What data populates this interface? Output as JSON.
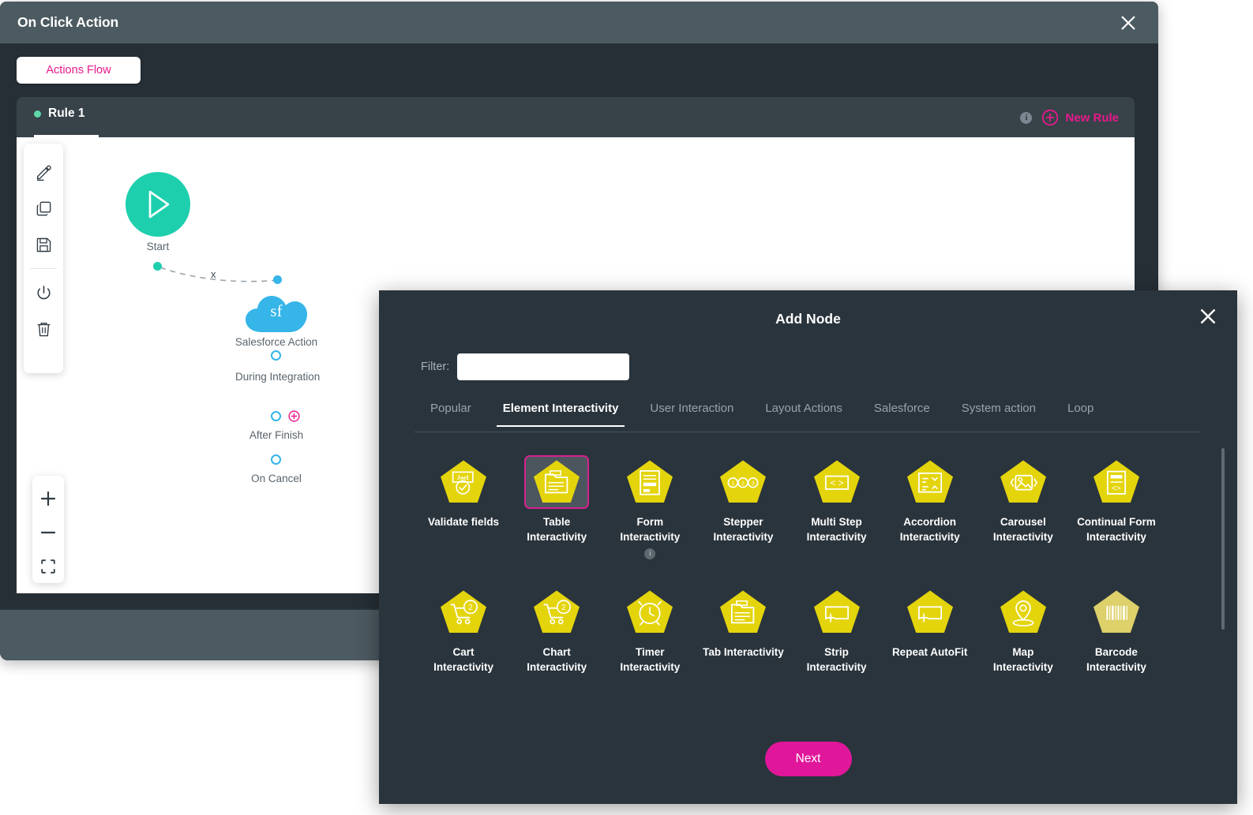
{
  "window": {
    "title": "On Click Action",
    "close_icon": "close-icon",
    "actions_flow_tab": "Actions Flow"
  },
  "rule_panel": {
    "tab_label": "Rule 1",
    "info_badge": "i",
    "new_rule_label": "New Rule",
    "new_rule_icon": "plus-circle-icon"
  },
  "canvas_toolbar": {
    "items": [
      {
        "name": "edit-tool",
        "icon": "pencil-icon"
      },
      {
        "name": "duplicate-tool",
        "icon": "copy-icon"
      },
      {
        "name": "save-tool",
        "icon": "save-icon"
      },
      {
        "name": "power-tool",
        "icon": "power-icon"
      },
      {
        "name": "delete-tool",
        "icon": "trash-icon"
      }
    ]
  },
  "zoom_controls": {
    "zoom_in": "+",
    "zoom_out": "–",
    "fit": "fit-to-screen-icon"
  },
  "flow": {
    "start_node": {
      "label": "Start",
      "icon": "play-icon"
    },
    "edge_label": "x",
    "salesforce_node": {
      "label": "Salesforce Action",
      "glyph": "sf",
      "icon": "cloud-icon"
    },
    "branches": [
      {
        "label": "During Integration",
        "port": "blue-ring"
      },
      {
        "label": "After Finish",
        "port": "blue-ring",
        "add_icon": "plus-circle-icon"
      },
      {
        "label": "On Cancel",
        "port": "blue-ring"
      }
    ]
  },
  "modal": {
    "title": "Add Node",
    "close_icon": "close-icon",
    "filter_label": "Filter:",
    "filter_value": "",
    "filter_placeholder": "",
    "tabs": [
      {
        "label": "Popular",
        "active": false
      },
      {
        "label": "Element Interactivity",
        "active": true
      },
      {
        "label": "User Interaction",
        "active": false
      },
      {
        "label": "Layout Actions",
        "active": false
      },
      {
        "label": "Salesforce",
        "active": false
      },
      {
        "label": "System action",
        "active": false
      },
      {
        "label": "Loop",
        "active": false
      }
    ],
    "nodes": [
      {
        "label": "Validate fields",
        "icon": "badge-check-icon",
        "selected": false,
        "info": false,
        "dim": false
      },
      {
        "label": "Table Interactivity",
        "icon": "table-icon",
        "selected": true,
        "info": false,
        "dim": false
      },
      {
        "label": "Form Interactivity",
        "icon": "form-icon",
        "selected": false,
        "info": true,
        "dim": false
      },
      {
        "label": "Stepper Interactivity",
        "icon": "stepper-icon",
        "selected": false,
        "info": false,
        "dim": false
      },
      {
        "label": "Multi Step Interactivity",
        "icon": "code-brackets-icon",
        "selected": false,
        "info": false,
        "dim": false
      },
      {
        "label": "Accordion Interactivity",
        "icon": "accordion-icon",
        "selected": false,
        "info": false,
        "dim": false
      },
      {
        "label": "Carousel Interactivity",
        "icon": "carousel-image-icon",
        "selected": false,
        "info": false,
        "dim": false
      },
      {
        "label": "Continual Form Interactivity",
        "icon": "continual-form-icon",
        "selected": false,
        "info": false,
        "dim": false
      },
      {
        "label": "Cart Interactivity",
        "icon": "cart-icon",
        "selected": false,
        "info": false,
        "dim": false
      },
      {
        "label": "Chart Interactivity",
        "icon": "cart-icon",
        "selected": false,
        "info": false,
        "dim": false
      },
      {
        "label": "Timer Interactivity",
        "icon": "alarm-clock-icon",
        "selected": false,
        "info": false,
        "dim": false
      },
      {
        "label": "Tab Interactivity",
        "icon": "tab-icon",
        "selected": false,
        "info": false,
        "dim": false
      },
      {
        "label": "Strip Interactivity",
        "icon": "strip-plus-icon",
        "selected": false,
        "info": false,
        "dim": false
      },
      {
        "label": "Repeat AutoFit",
        "icon": "strip-plus-icon",
        "selected": false,
        "info": false,
        "dim": false
      },
      {
        "label": "Map Interactivity",
        "icon": "map-pin-icon",
        "selected": false,
        "info": false,
        "dim": false
      },
      {
        "label": "Barcode Interactivity",
        "icon": "barcode-icon",
        "selected": false,
        "info": false,
        "dim": true
      }
    ],
    "next_label": "Next",
    "node_info_glyph": "i"
  },
  "colors": {
    "accent_magenta": "#e8198b",
    "node_yellow": "#e4d40c",
    "node_yellow_dim": "#ded06a",
    "start_green": "#1ecfae",
    "salesforce_blue": "#35b5e8",
    "titlebar": "#4c5a61",
    "modal_bg": "#2a343c",
    "panel_bg": "#374249"
  }
}
